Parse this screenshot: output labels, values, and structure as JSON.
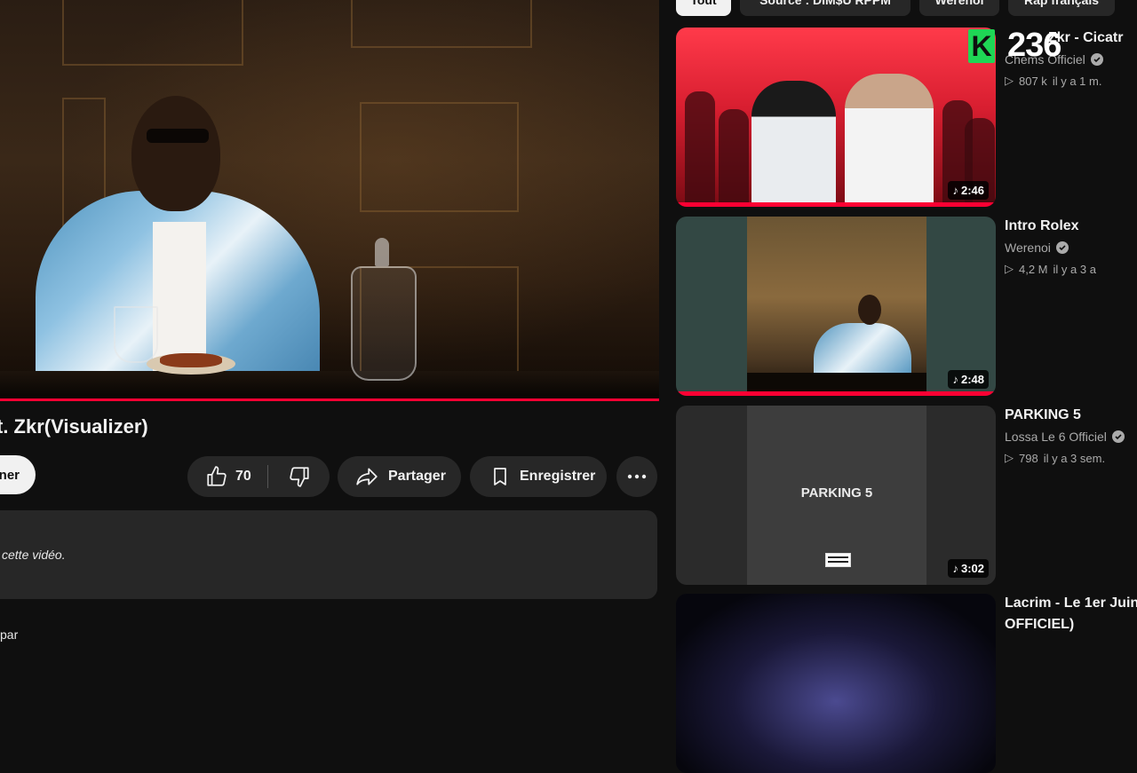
{
  "video": {
    "title": "t. Zkr(Visualizer)",
    "progress_fraction": 1.0,
    "subscribe_label": "ner",
    "likes": "70",
    "share_label": "Partager",
    "save_label": "Enregistrer",
    "description_text": "cette vidéo.",
    "below_text": "par"
  },
  "chips": [
    "Tout",
    "Source : DIM$U RPPM",
    "Werenoi",
    "Rap français"
  ],
  "recommendations": [
    {
      "title": "Zkr - Cicatr",
      "channel": "Chems Officiel",
      "views": "807 k",
      "age": "il y a 1 m.",
      "duration": "2:46",
      "overlay_logo": "K",
      "overlay_number": "236",
      "watched": true
    },
    {
      "title": "Intro Rolex",
      "channel": "Werenoi",
      "views": "4,2 M",
      "age": "il y a 3 a",
      "duration": "2:48",
      "watched": true
    },
    {
      "title": "PARKING 5",
      "channel": "Lossa Le 6 Officiel",
      "views": "798",
      "age": "il y a 3 sem.",
      "duration": "3:02",
      "cover_text": "PARKING 5",
      "watched": false
    },
    {
      "title_line1": "Lacrim - Le 1er Juin",
      "title_line2": "OFFICIEL)"
    }
  ],
  "icons": {
    "like": "thumbs-up-icon",
    "dislike": "thumbs-down-icon",
    "share": "share-arrow-icon",
    "save": "bookmark-icon",
    "more": "more-horizontal-icon",
    "verified": "verified-check-icon",
    "views": "play-outline-icon",
    "duration": "music-note-icon"
  },
  "colors": {
    "background": "#0f0f0f",
    "button_bg": "#272727",
    "accent_red": "#ff0033",
    "secondary_text": "#aaaaaa",
    "logo_green": "#1fd655"
  }
}
